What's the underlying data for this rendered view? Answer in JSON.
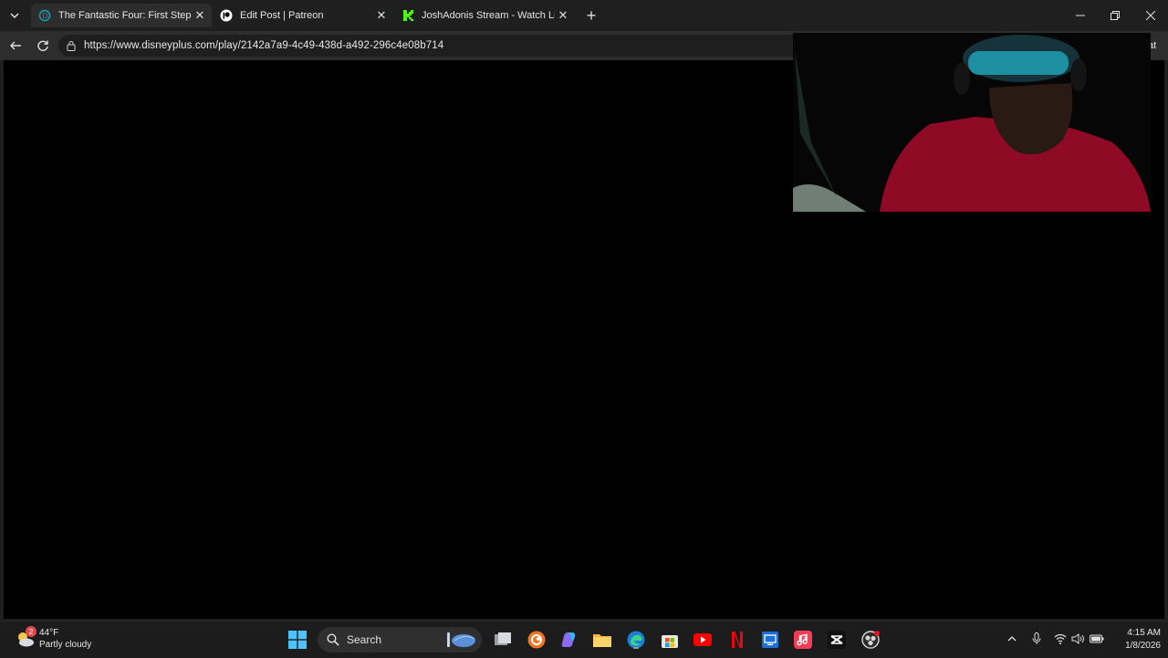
{
  "browser": {
    "tabs": [
      {
        "title": "The Fantastic Four: First Steps | Dis",
        "favicon": "disney-icon",
        "active": true
      },
      {
        "title": "Edit Post | Patreon",
        "favicon": "patreon-icon",
        "active": false
      },
      {
        "title": "JoshAdonis Stream - Watch Live on",
        "favicon": "kick-icon",
        "active": false
      }
    ],
    "new_tab_label": "+",
    "url": "https://www.disneyplus.com/play/2142a7a9-4c49-438d-a492-296c4e08b714",
    "chat_label": "Chat"
  },
  "page": {
    "background": "#000000"
  },
  "taskbar": {
    "weather": {
      "temp": "44°F",
      "condition": "Partly cloudy",
      "badge": "2"
    },
    "search_label": "Search",
    "clock": {
      "time": "4:15 AM",
      "date": "1/8/2026"
    }
  }
}
